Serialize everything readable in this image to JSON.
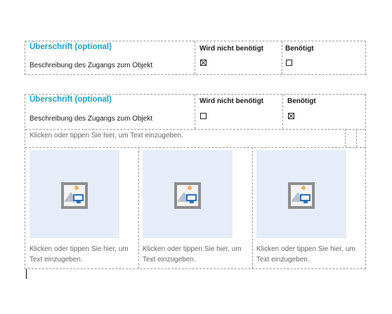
{
  "table1": {
    "heading": "Überschrift (optional)",
    "description": "Beschreibung des Zugangs zum Objekt",
    "col_not_needed": "Wird nicht benötigt",
    "col_needed": "Benötigt",
    "not_needed_checked": true,
    "needed_checked": false
  },
  "table2": {
    "heading": "Überschrift (optional)",
    "description": "Beschreibung des Zugangs zum Objekt",
    "col_not_needed": "Wird nicht benötigt",
    "col_needed": "Benötigt",
    "not_needed_checked": false,
    "needed_checked": true,
    "text_placeholder": "Klicken oder tippen Sie hier, um Text einzugeben.",
    "images": [
      {
        "icon": "picture-placeholder-icon",
        "caption_line1": "Klicken oder tippen Sie hier, um",
        "caption_line2": "Text einzugeben."
      },
      {
        "icon": "picture-placeholder-icon",
        "caption_line1": "Klicken oder tippen Sie hier, um",
        "caption_line2": "Text einzugeben."
      },
      {
        "icon": "picture-placeholder-icon",
        "caption_line1": "Klicken oder tippen Sie hier, um",
        "caption_line2": "Text einzugeben."
      }
    ]
  },
  "colors": {
    "heading": "#1aa0c8",
    "image_placeholder_bg": "#e6edf8",
    "border": "#9a9a9a"
  }
}
